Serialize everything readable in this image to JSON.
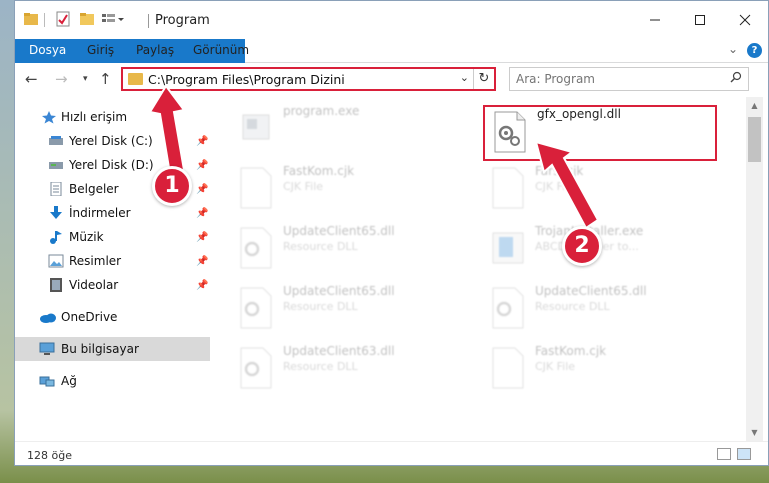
{
  "window": {
    "title": "Program"
  },
  "ribbon": {
    "tabs": [
      {
        "label": "Dosya"
      },
      {
        "label": "Giriş"
      },
      {
        "label": "Paylaş"
      },
      {
        "label": "Görünüm"
      }
    ]
  },
  "navbar": {
    "address": "C:\\Program Files\\Program Dizini",
    "search_placeholder": "Ara: Program"
  },
  "sidebar": {
    "items": [
      {
        "label": "Hızlı erişim",
        "icon": "star-icon"
      },
      {
        "label": "Yerel Disk (C:)",
        "icon": "drive-icon",
        "pinned": true
      },
      {
        "label": "Yerel Disk (D:)",
        "icon": "drive-icon",
        "pinned": true
      },
      {
        "label": "Belgeler",
        "icon": "documents-icon",
        "pinned": true
      },
      {
        "label": "İndirmeler",
        "icon": "download-icon",
        "pinned": true
      },
      {
        "label": "Müzik",
        "icon": "music-icon",
        "pinned": true
      },
      {
        "label": "Resimler",
        "icon": "pictures-icon",
        "pinned": true
      },
      {
        "label": "Videolar",
        "icon": "video-icon",
        "pinned": true
      },
      {
        "label": "OneDrive",
        "icon": "cloud-icon"
      },
      {
        "label": "Bu bilgisayar",
        "icon": "computer-icon",
        "selected": true
      },
      {
        "label": "Ağ",
        "icon": "network-icon"
      }
    ]
  },
  "files": [
    {
      "name": "program.exe",
      "type": ""
    },
    {
      "name": "gfx_opengl.dll",
      "type": ""
    },
    {
      "name": "FastKom.cjk",
      "type": "CJK File"
    },
    {
      "name": "Farsi.cjk",
      "type": "CJK File"
    },
    {
      "name": "UpdateClient65.dll",
      "type": "Resource DLL"
    },
    {
      "name": "TrojanInstaller.exe",
      "type": "ABCD Installer to..."
    },
    {
      "name": "UpdateClient65.dll",
      "type": "Resource DLL"
    },
    {
      "name": "UpdateClient65.dll",
      "type": "Resource DLL"
    },
    {
      "name": "UpdateClient63.dll",
      "type": "Resource DLL"
    },
    {
      "name": "FastKom.cjk",
      "type": "CJK File"
    }
  ],
  "status": {
    "count": "128 öğe"
  },
  "annotations": {
    "step1": "1",
    "step2": "2"
  },
  "colors": {
    "accent": "#1979ca",
    "highlight": "#d9203a"
  }
}
